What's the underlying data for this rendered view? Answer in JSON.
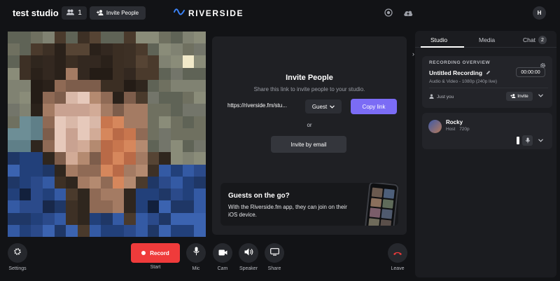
{
  "header": {
    "studio_name": "test studio",
    "people_count": "1",
    "invite_label": "Invite People",
    "logo_text": "RIVERSIDE",
    "avatar_initial": "H"
  },
  "invite": {
    "title": "Invite People",
    "subtitle": "Share this link to invite people to your studio.",
    "link": "https://riverside.fm/stu...",
    "role": "Guest",
    "copy_label": "Copy link",
    "or_label": "or",
    "email_label": "Invite by email",
    "guests_title": "Guests on the go?",
    "guests_desc": "With the Riverside.fm app, they can join on their iOS device."
  },
  "sidebar": {
    "tabs": [
      {
        "label": "Studio",
        "active": true
      },
      {
        "label": "Media",
        "active": false
      },
      {
        "label": "Chat",
        "active": false,
        "badge": "2"
      }
    ],
    "recording": {
      "section_label": "RECORDING OVERVIEW",
      "title": "Untitled Recording",
      "details": "Audio & Video - 1080p (240p live)",
      "timer": "00:00:00",
      "participants_label": "Just you",
      "invite_label": "Invite"
    },
    "participant": {
      "name": "Rocky",
      "role": "Host",
      "quality": "720p"
    }
  },
  "controls": {
    "settings": "Settings",
    "record": "Record",
    "start": "Start",
    "mic": "Mic",
    "cam": "Cam",
    "speaker": "Speaker",
    "share": "Share",
    "leave": "Leave"
  },
  "colors": {
    "accent": "#7b6cf5",
    "record": "#ef3b3b",
    "leave": "#ef3b3b",
    "logo": "#3b82f6"
  }
}
